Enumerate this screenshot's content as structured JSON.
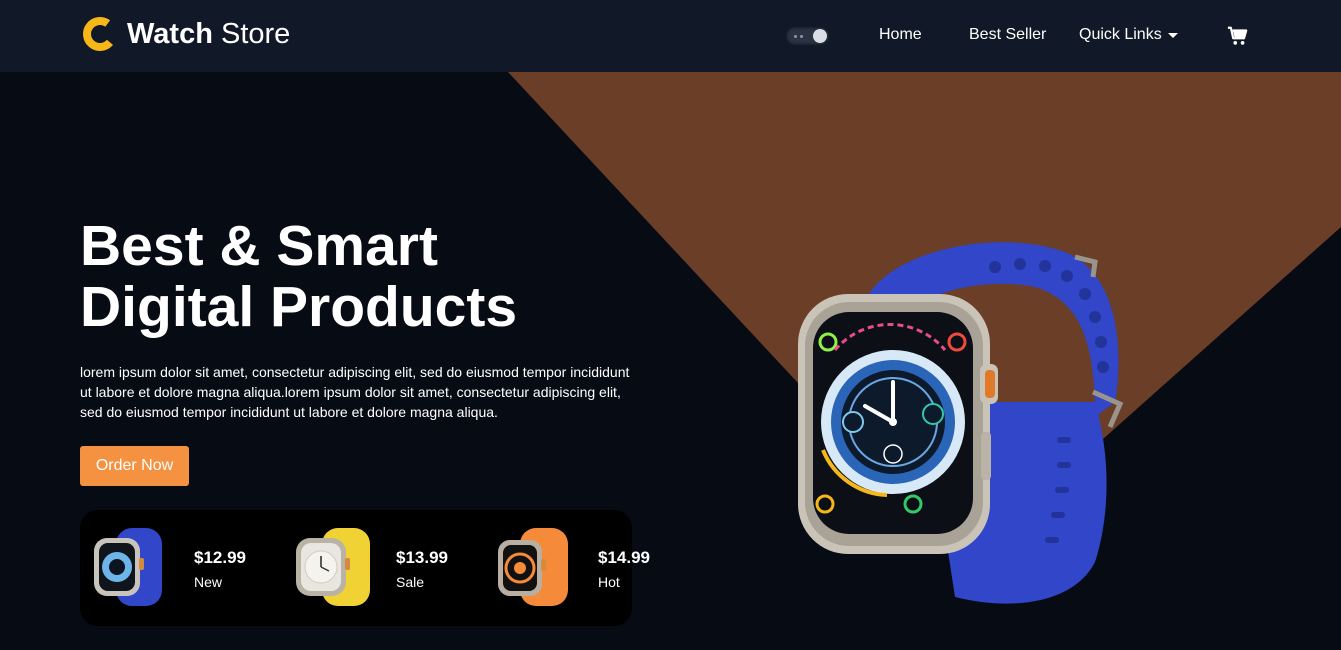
{
  "brand": {
    "name_bold": "Watch",
    "name_regular": " Store",
    "accent": "#f5b818"
  },
  "nav": {
    "theme_toggle": "theme-toggle",
    "links": [
      {
        "label": "Home"
      },
      {
        "label": "Best Seller"
      },
      {
        "label": "Quick Links"
      }
    ],
    "cart_icon": "cart-icon"
  },
  "hero": {
    "title_line1": "Best & Smart",
    "title_line2": "Digital Products",
    "description": "lorem ipsum dolor sit amet, consectetur adipiscing elit, sed do eiusmod tempor incididunt ut labore et dolore magna aliqua.lorem ipsum dolor sit amet, consectetur adipiscing elit, sed do eiusmod tempor incididunt ut labore et dolore magna aliqua.",
    "cta_label": "Order Now",
    "cta_color": "#f59241",
    "shape_color": "#6b3e28"
  },
  "products": [
    {
      "price": "$12.99",
      "tag": "New",
      "band_color": "#3146c8"
    },
    {
      "price": "$13.99",
      "tag": "Sale",
      "band_color": "#f0d234"
    },
    {
      "price": "$14.99",
      "tag": "Hot",
      "band_color": "#f58a3a"
    }
  ]
}
